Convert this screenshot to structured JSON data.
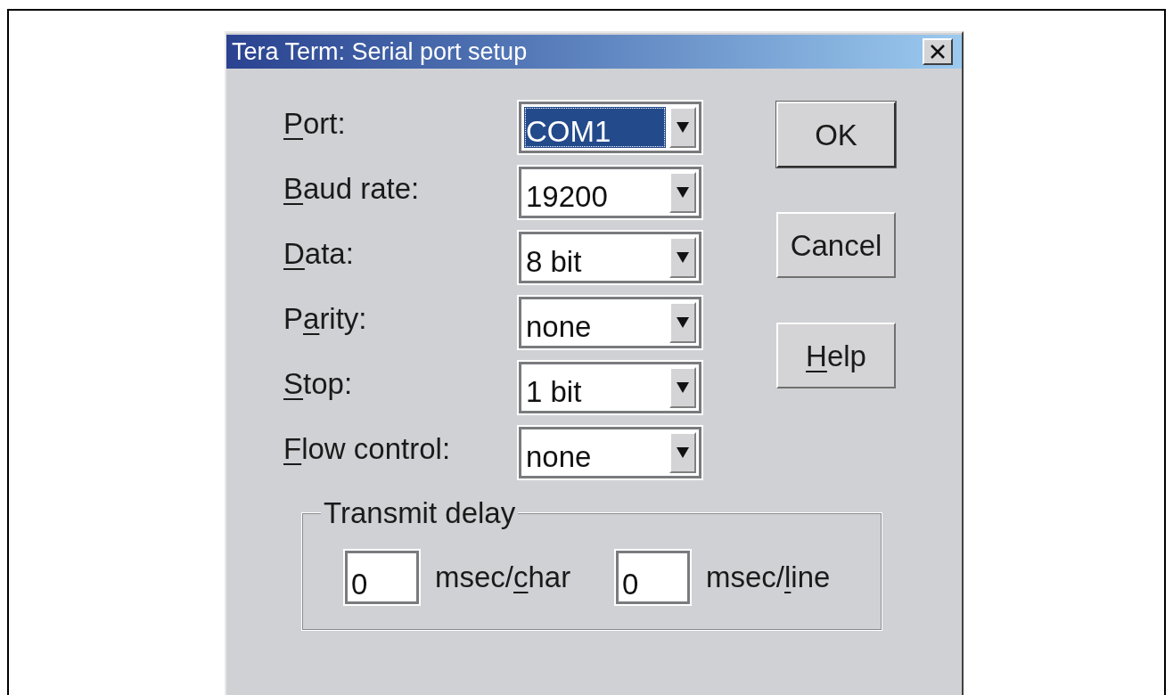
{
  "window": {
    "title": "Tera Term: Serial port setup"
  },
  "fields": [
    {
      "label": [
        {
          "text": "P",
          "underlined": true
        },
        {
          "text": "ort:",
          "underlined": false
        }
      ],
      "value": "COM1",
      "selected": true
    },
    {
      "label": [
        {
          "text": "B",
          "underlined": true
        },
        {
          "text": "aud rate:",
          "underlined": false
        }
      ],
      "value": "19200",
      "selected": false
    },
    {
      "label": [
        {
          "text": "D",
          "underlined": true
        },
        {
          "text": "ata:",
          "underlined": false
        }
      ],
      "value": "8 bit",
      "selected": false
    },
    {
      "label": [
        {
          "text": "P",
          "underlined": false
        },
        {
          "text": "a",
          "underlined": true
        },
        {
          "text": "rity:",
          "underlined": false
        }
      ],
      "value": "none",
      "selected": false
    },
    {
      "label": [
        {
          "text": "S",
          "underlined": true
        },
        {
          "text": "top:",
          "underlined": false
        }
      ],
      "value": "1 bit",
      "selected": false
    },
    {
      "label": [
        {
          "text": "F",
          "underlined": true
        },
        {
          "text": "low control:",
          "underlined": false
        }
      ],
      "value": "none",
      "selected": false
    }
  ],
  "buttons": [
    {
      "label": [
        {
          "text": "OK",
          "underlined": false
        }
      ],
      "default": true
    },
    {
      "label": [
        {
          "text": "Cancel",
          "underlined": false
        }
      ],
      "default": false
    },
    {
      "label": [
        {
          "text": "H",
          "underlined": true
        },
        {
          "text": "elp",
          "underlined": false
        }
      ],
      "default": false
    }
  ],
  "transmit_delay": {
    "legend": "Transmit delay",
    "entries": [
      {
        "value": "0",
        "unit": [
          {
            "text": "msec/",
            "underlined": false
          },
          {
            "text": "c",
            "underlined": true
          },
          {
            "text": "har",
            "underlined": false
          }
        ]
      },
      {
        "value": "0",
        "unit": [
          {
            "text": "msec/",
            "underlined": false
          },
          {
            "text": "l",
            "underlined": true
          },
          {
            "text": "ine",
            "underlined": false
          }
        ]
      }
    ]
  }
}
